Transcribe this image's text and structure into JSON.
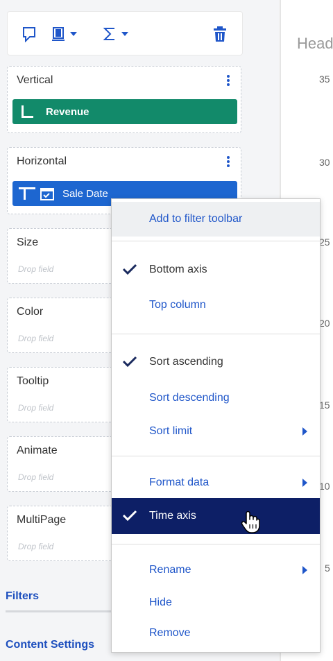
{
  "toolbar": {
    "icons": [
      "comment-icon",
      "chart-type-icon",
      "sum-icon",
      "trash-icon"
    ]
  },
  "wells": {
    "vertical": {
      "title": "Vertical",
      "field": "Revenue"
    },
    "horizontal": {
      "title": "Horizontal",
      "field": "Sale Date"
    },
    "size": {
      "title": "Size",
      "placeholder": "Drop field"
    },
    "color": {
      "title": "Color",
      "placeholder": "Drop field"
    },
    "tooltip": {
      "title": "Tooltip",
      "placeholder": "Drop field"
    },
    "animate": {
      "title": "Animate",
      "placeholder": "Drop field"
    },
    "multipage": {
      "title": "MultiPage",
      "placeholder": "Drop field"
    }
  },
  "sections": {
    "filters": "Filters",
    "content_settings": "Content Settings"
  },
  "chart": {
    "title": "Head",
    "y_ticks": [
      "35",
      "30",
      "25",
      "20",
      "15",
      "10",
      "5"
    ]
  },
  "context_menu": {
    "add_to_filter": "Add to filter toolbar",
    "bottom_axis": "Bottom axis",
    "top_column": "Top column",
    "sort_ascending": "Sort ascending",
    "sort_descending": "Sort descending",
    "sort_limit": "Sort limit",
    "format_data": "Format data",
    "time_axis": "Time axis",
    "rename": "Rename",
    "hide": "Hide",
    "remove": "Remove"
  },
  "colors": {
    "accent": "#1f56c9",
    "revenue_pill": "#128a6a",
    "date_pill": "#1d66d0",
    "menu_selected": "#0d1f66"
  }
}
